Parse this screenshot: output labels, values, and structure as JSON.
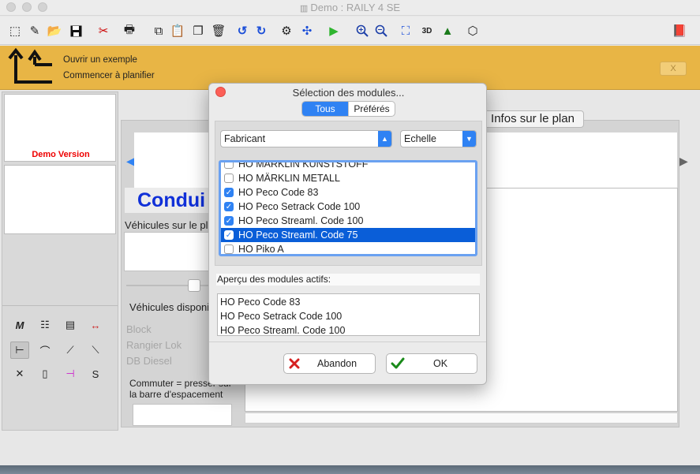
{
  "window": {
    "title": "Demo : RAILY 4 SE"
  },
  "toolbar": {
    "icons": [
      "new-icon",
      "open-icon",
      "folder-icon",
      "save-icon",
      "cut-icon",
      "print-icon",
      "copy-icon",
      "paste-icon",
      "duplicate-icon",
      "delete-icon",
      "undo-icon",
      "redo-icon",
      "layers-icon",
      "info-icon",
      "play-icon",
      "zoom-in-icon",
      "zoom-out-icon",
      "fit-icon",
      "3d-icon",
      "terrain-icon",
      "box-icon",
      "book-icon"
    ]
  },
  "banner": {
    "open_example": "Ouvrir un exemple",
    "start_planning": "Commencer à planifier",
    "close_label": "X",
    "color": "#e8b545"
  },
  "left_panel": {
    "demo_label": "Demo Version"
  },
  "main": {
    "infos_tab": "Infos sur le plan",
    "conduite_title": "Condui",
    "vehicles_on_plan": "Véhicules sur le pl",
    "vehicles_available": "Véhicules disponi",
    "vehicle_list": [
      "Block",
      "Rangier Lok",
      "DB Diesel"
    ],
    "switch_hint_1": "Commuter = presser sur",
    "switch_hint_2": "la barre d'espacement"
  },
  "modal": {
    "title": "Sélection des modules...",
    "tabs": [
      "Tous",
      "Préférés"
    ],
    "manufacturer_select": "Fabricant",
    "scale_select": "Echelle",
    "modules": [
      {
        "label": "HO MÄRKLIN KUNSTSTOFF",
        "checked": false,
        "selected": false
      },
      {
        "label": "HO MÄRKLIN METALL",
        "checked": false,
        "selected": false
      },
      {
        "label": "HO Peco Code 83",
        "checked": true,
        "selected": false
      },
      {
        "label": "HO Peco Setrack Code 100",
        "checked": true,
        "selected": false
      },
      {
        "label": "HO Peco Streaml. Code 100",
        "checked": true,
        "selected": false
      },
      {
        "label": "HO Peco Streaml. Code 75",
        "checked": true,
        "selected": true
      },
      {
        "label": "HO Piko A",
        "checked": false,
        "selected": false
      }
    ],
    "active_label": "Aperçu des modules actifs:",
    "active_modules": [
      "HO Peco Code 83",
      "HO Peco Setrack Code 100",
      "HO Peco Streaml. Code 100"
    ],
    "cancel_label": "Abandon",
    "ok_label": "OK",
    "accent_color": "#2f82f3"
  }
}
